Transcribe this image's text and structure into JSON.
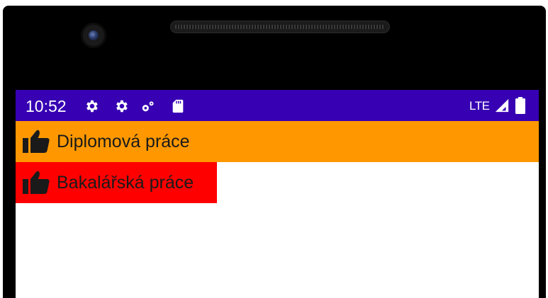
{
  "status_bar": {
    "time": "10:52",
    "network": "LTE",
    "background_color": "#3700b3",
    "icons": [
      "settings-gear-icon",
      "settings-gear-icon",
      "debug-settings-icon",
      "sd-card-icon",
      "signal-icon",
      "battery-icon"
    ]
  },
  "list": {
    "items": [
      {
        "label": "Diplomová práce",
        "icon": "thumbs-up-icon",
        "background_color": "#ff9800"
      },
      {
        "label": "Bakalářská práce",
        "icon": "thumbs-up-icon",
        "background_color": "#ff0000"
      }
    ]
  }
}
